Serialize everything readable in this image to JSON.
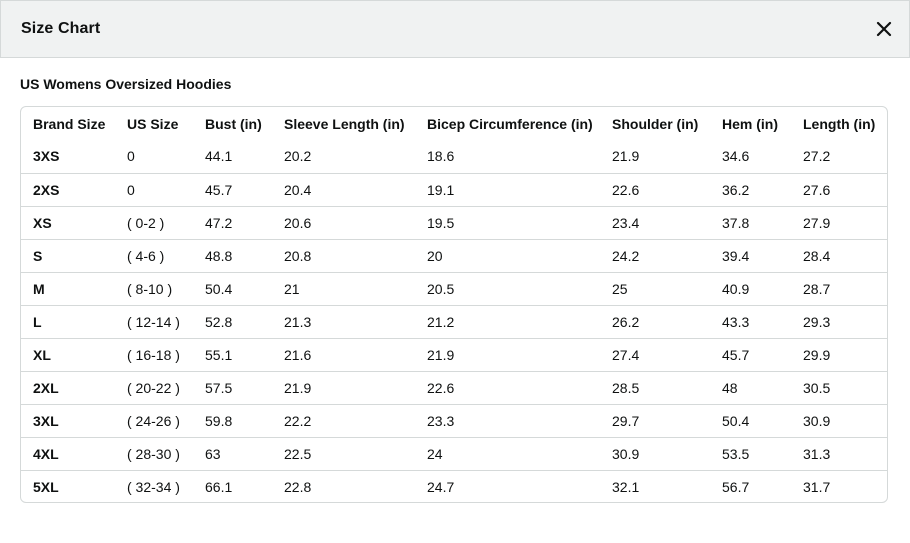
{
  "modal": {
    "title": "Size Chart",
    "close_label": "close"
  },
  "chart": {
    "subtitle": "US Womens Oversized Hoodies",
    "columns": [
      "Brand Size",
      "US Size",
      "Bust (in)",
      "Sleeve Length (in)",
      "Bicep Circumference (in)",
      "Shoulder (in)",
      "Hem (in)",
      "Length (in)"
    ],
    "rows": [
      [
        "3XS",
        "0",
        "44.1",
        "20.2",
        "18.6",
        "21.9",
        "34.6",
        "27.2"
      ],
      [
        "2XS",
        "0",
        "45.7",
        "20.4",
        "19.1",
        "22.6",
        "36.2",
        "27.6"
      ],
      [
        "XS",
        "( 0-2 )",
        "47.2",
        "20.6",
        "19.5",
        "23.4",
        "37.8",
        "27.9"
      ],
      [
        "S",
        "( 4-6 )",
        "48.8",
        "20.8",
        "20",
        "24.2",
        "39.4",
        "28.4"
      ],
      [
        "M",
        "( 8-10 )",
        "50.4",
        "21",
        "20.5",
        "25",
        "40.9",
        "28.7"
      ],
      [
        "L",
        "( 12-14 )",
        "52.8",
        "21.3",
        "21.2",
        "26.2",
        "43.3",
        "29.3"
      ],
      [
        "XL",
        "( 16-18 )",
        "55.1",
        "21.6",
        "21.9",
        "27.4",
        "45.7",
        "29.9"
      ],
      [
        "2XL",
        "( 20-22 )",
        "57.5",
        "21.9",
        "22.6",
        "28.5",
        "48",
        "30.5"
      ],
      [
        "3XL",
        "( 24-26 )",
        "59.8",
        "22.2",
        "23.3",
        "29.7",
        "50.4",
        "30.9"
      ],
      [
        "4XL",
        "( 28-30 )",
        "63",
        "22.5",
        "24",
        "30.9",
        "53.5",
        "31.3"
      ],
      [
        "5XL",
        "( 32-34 )",
        "66.1",
        "22.8",
        "24.7",
        "32.1",
        "56.7",
        "31.7"
      ]
    ]
  },
  "colors": {
    "header_bg": "#f0f2f2",
    "border": "#d5d9d9",
    "text": "#0f1111"
  }
}
